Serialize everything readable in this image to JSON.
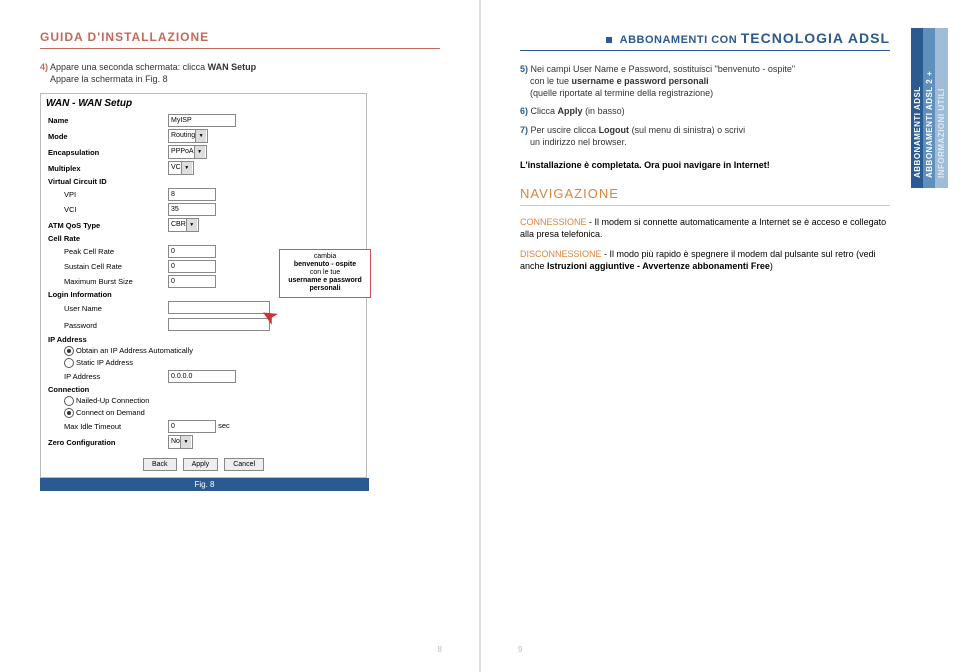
{
  "left": {
    "header": "GUIDA D'INSTALLAZIONE",
    "step4_num": "4)",
    "step4_line1": "Appare una seconda schermata: clicca ",
    "step4_bold": "WAN Setup",
    "step4_line2": "Appare la schermata in Fig. 8"
  },
  "wan": {
    "title": "WAN - WAN Setup",
    "labels": {
      "name": "Name",
      "mode": "Mode",
      "encap": "Encapsulation",
      "multi": "Multiplex",
      "vcid": "Virtual Circuit ID",
      "vpi": "VPI",
      "vci": "VCI",
      "atm": "ATM QoS Type",
      "cellrate": "Cell Rate",
      "peak": "Peak Cell Rate",
      "sustain": "Sustain Cell Rate",
      "maxburst": "Maximum Burst Size",
      "login": "Login Information",
      "user": "User Name",
      "pass": "Password",
      "ipaddr": "IP Address",
      "obtain": "Obtain an IP Address Automatically",
      "static": "Static IP Address",
      "ipfield": "IP Address",
      "conn": "Connection",
      "nailed": "Nailed-Up Connection",
      "demand": "Connect on Demand",
      "idle": "Max Idle Timeout",
      "sec": "sec",
      "zero": "Zero Configuration"
    },
    "values": {
      "name": "MyISP",
      "mode": "Routing",
      "encap": "PPPoA",
      "multi": "VC",
      "vpi": "8",
      "vci": "35",
      "atm": "CBR",
      "peak": "0",
      "sustain": "0",
      "maxburst": "0",
      "ip": "0.0.0.0",
      "idle": "0",
      "zero": "No"
    },
    "btns": {
      "back": "Back",
      "apply": "Apply",
      "cancel": "Cancel"
    },
    "callout": "cambia\nbenvenuto - ospite\ncon le tue\nusername e password\npersonali",
    "figcap": "Fig. 8"
  },
  "right": {
    "header_pre": "ABBONAMENTI CON ",
    "header_big": "TECNOLOGIA ADSL",
    "step5_num": "5)",
    "step5": [
      "Nei campi User Name e Password, sostituisci \"benvenuto - ospite\"",
      "con le tue ",
      "username e password personali",
      "(quelle riportate al termine della registrazione)"
    ],
    "step6_num": "6)",
    "step6": [
      "Clicca ",
      "Apply",
      " (in basso)"
    ],
    "step7_num": "7)",
    "step7": [
      "Per uscire clicca ",
      "Logout",
      " (sul menu di sinistra) o scrivi",
      "un indirizzo nel browser."
    ],
    "done": "L'installazione è completata. Ora puoi navigare in Internet!",
    "nav_title": "NAVIGAZIONE",
    "conn_label": "CONNESSIONE",
    "conn_text": " - Il modem si connette automaticamente a Internet se è acceso e collegato alla presa telefonica.",
    "disc_label": "DISCONNESSIONE",
    "disc_text": " - Il modo più rapido è spegnere il modem dal pulsante sul retro (vedi anche ",
    "disc_bold": "Istruzioni aggiuntive - Avvertenze abbonamenti Free",
    "disc_end": ")"
  },
  "tabs": {
    "t1": "ABBONAMENTI ADSL",
    "t2": "ABBONAMENTI ADSL 2 +",
    "t3": "INFORMAZIONI UTILI"
  },
  "pagenum": {
    "left": "8",
    "right": "9"
  }
}
